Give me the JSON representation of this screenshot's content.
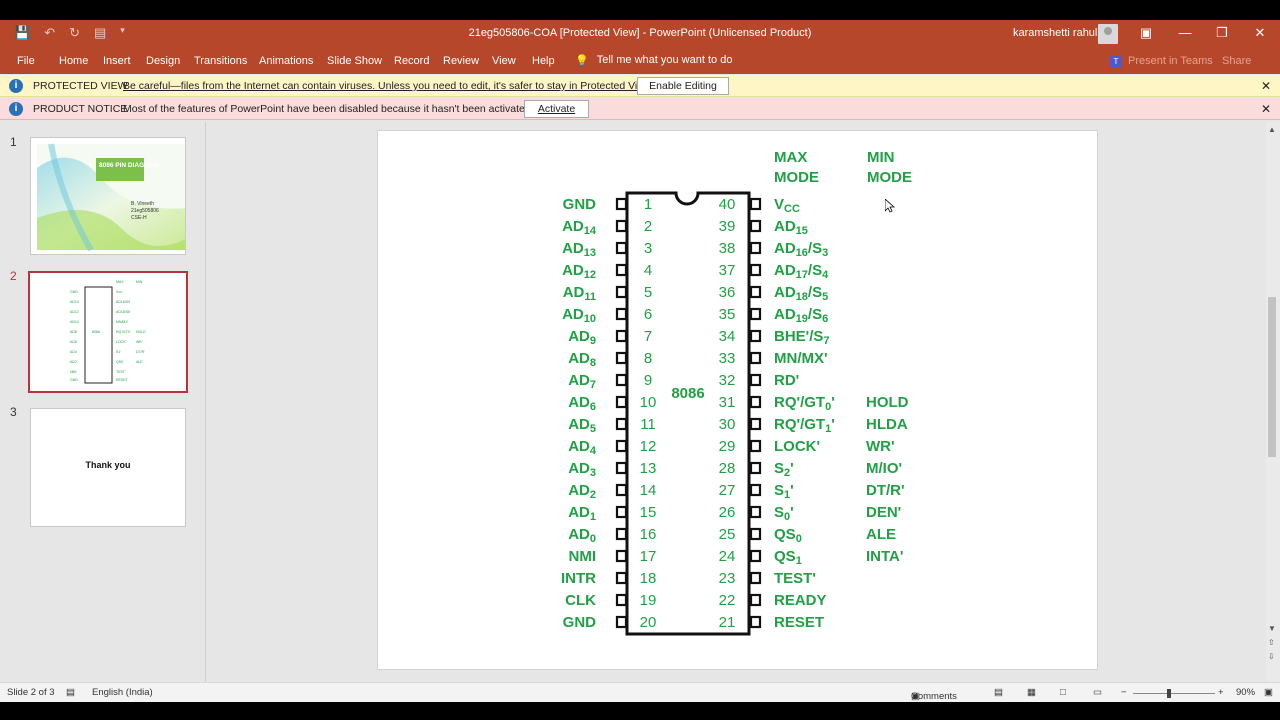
{
  "window": {
    "title": "21eg505806-COA [Protected View]  -  PowerPoint (Unlicensed Product)",
    "user": "karamshetti rahul"
  },
  "ribbon": {
    "tabs": [
      "File",
      "Home",
      "Insert",
      "Design",
      "Transitions",
      "Animations",
      "Slide Show",
      "Record",
      "Review",
      "View",
      "Help"
    ],
    "tell_me": "Tell me what you want to do",
    "present_teams": "Present in Teams",
    "share": "Share"
  },
  "protected_view": {
    "label": "PROTECTED VIEW",
    "message": "Be careful—files from the Internet can contain viruses. Unless you need to edit, it's safer to stay in Protected View.",
    "button": "Enable Editing"
  },
  "product_notice": {
    "label": "PRODUCT NOTICE",
    "message": "Most of the features of PowerPoint have been disabled because it hasn't been activated.",
    "button": "Activate"
  },
  "thumbnails": [
    {
      "num": "1",
      "title": "8086 PIN DIAGRAM",
      "author_lines": [
        "B. Vineeth",
        "21eg505806",
        "CSE-H"
      ]
    },
    {
      "num": "2"
    },
    {
      "num": "3",
      "text": "Thank you"
    }
  ],
  "slide": {
    "chip_label": "8086",
    "max_mode_header": [
      "MAX",
      "MODE"
    ],
    "min_mode_header": [
      "MIN",
      "MODE"
    ],
    "left_pins": [
      {
        "num": "1",
        "name": "GND"
      },
      {
        "num": "2",
        "name": "AD",
        "sub": "14"
      },
      {
        "num": "3",
        "name": "AD",
        "sub": "13"
      },
      {
        "num": "4",
        "name": "AD",
        "sub": "12"
      },
      {
        "num": "5",
        "name": "AD",
        "sub": "11"
      },
      {
        "num": "6",
        "name": "AD",
        "sub": "10"
      },
      {
        "num": "7",
        "name": "AD",
        "sub": "9"
      },
      {
        "num": "8",
        "name": "AD",
        "sub": "8"
      },
      {
        "num": "9",
        "name": "AD",
        "sub": "7"
      },
      {
        "num": "10",
        "name": "AD",
        "sub": "6"
      },
      {
        "num": "11",
        "name": "AD",
        "sub": "5"
      },
      {
        "num": "12",
        "name": "AD",
        "sub": "4"
      },
      {
        "num": "13",
        "name": "AD",
        "sub": "3"
      },
      {
        "num": "14",
        "name": "AD",
        "sub": "2"
      },
      {
        "num": "15",
        "name": "AD",
        "sub": "1"
      },
      {
        "num": "16",
        "name": "AD",
        "sub": "0"
      },
      {
        "num": "17",
        "name": "NMI"
      },
      {
        "num": "18",
        "name": "INTR"
      },
      {
        "num": "19",
        "name": "CLK"
      },
      {
        "num": "20",
        "name": "GND"
      }
    ],
    "right_pins": [
      {
        "num": "40",
        "max": "V",
        "max_sub": "CC",
        "min": ""
      },
      {
        "num": "39",
        "max": "AD",
        "max_sub": "15",
        "min": ""
      },
      {
        "num": "38",
        "max": "AD",
        "max_sub": "16",
        "max_tail": "/S",
        "max_tail_sub": "3",
        "min": ""
      },
      {
        "num": "37",
        "max": "AD",
        "max_sub": "17",
        "max_tail": "/S",
        "max_tail_sub": "4",
        "min": ""
      },
      {
        "num": "36",
        "max": "AD",
        "max_sub": "18",
        "max_tail": "/S",
        "max_tail_sub": "5",
        "min": ""
      },
      {
        "num": "35",
        "max": "AD",
        "max_sub": "19",
        "max_tail": "/S",
        "max_tail_sub": "6",
        "min": ""
      },
      {
        "num": "34",
        "max": "BHE'/S",
        "max_sub": "7",
        "min": ""
      },
      {
        "num": "33",
        "max": "MN/MX'",
        "min": ""
      },
      {
        "num": "32",
        "max": "RD'",
        "min": ""
      },
      {
        "num": "31",
        "max": "RQ'/GT",
        "max_sub": "0",
        "max_tail": "'",
        "min": "HOLD"
      },
      {
        "num": "30",
        "max": "RQ'/GT",
        "max_sub": "1",
        "max_tail": "'",
        "min": "HLDA"
      },
      {
        "num": "29",
        "max": "LOCK'",
        "min": "WR'"
      },
      {
        "num": "28",
        "max": "S",
        "max_sub": "2",
        "max_tail": "'",
        "min": "M/IO'"
      },
      {
        "num": "27",
        "max": "S",
        "max_sub": "1",
        "max_tail": "'",
        "min": "DT/R'"
      },
      {
        "num": "26",
        "max": "S",
        "max_sub": "0",
        "max_tail": "'",
        "min": "DEN'"
      },
      {
        "num": "25",
        "max": "QS",
        "max_sub": "0",
        "min": "ALE"
      },
      {
        "num": "24",
        "max": "QS",
        "max_sub": "1",
        "min": "INTA'"
      },
      {
        "num": "23",
        "max": "TEST'",
        "min": ""
      },
      {
        "num": "22",
        "max": "READY",
        "min": ""
      },
      {
        "num": "21",
        "max": "RESET",
        "min": ""
      }
    ]
  },
  "status": {
    "slide_info": "Slide 2 of 3",
    "language": "English (India)",
    "comments": "Comments",
    "zoom": "90%"
  },
  "colors": {
    "accent": "#b7472a",
    "pin_green": "#22a046",
    "protected_bg": "#fff6c6",
    "notice_bg": "#fbdcdc"
  }
}
